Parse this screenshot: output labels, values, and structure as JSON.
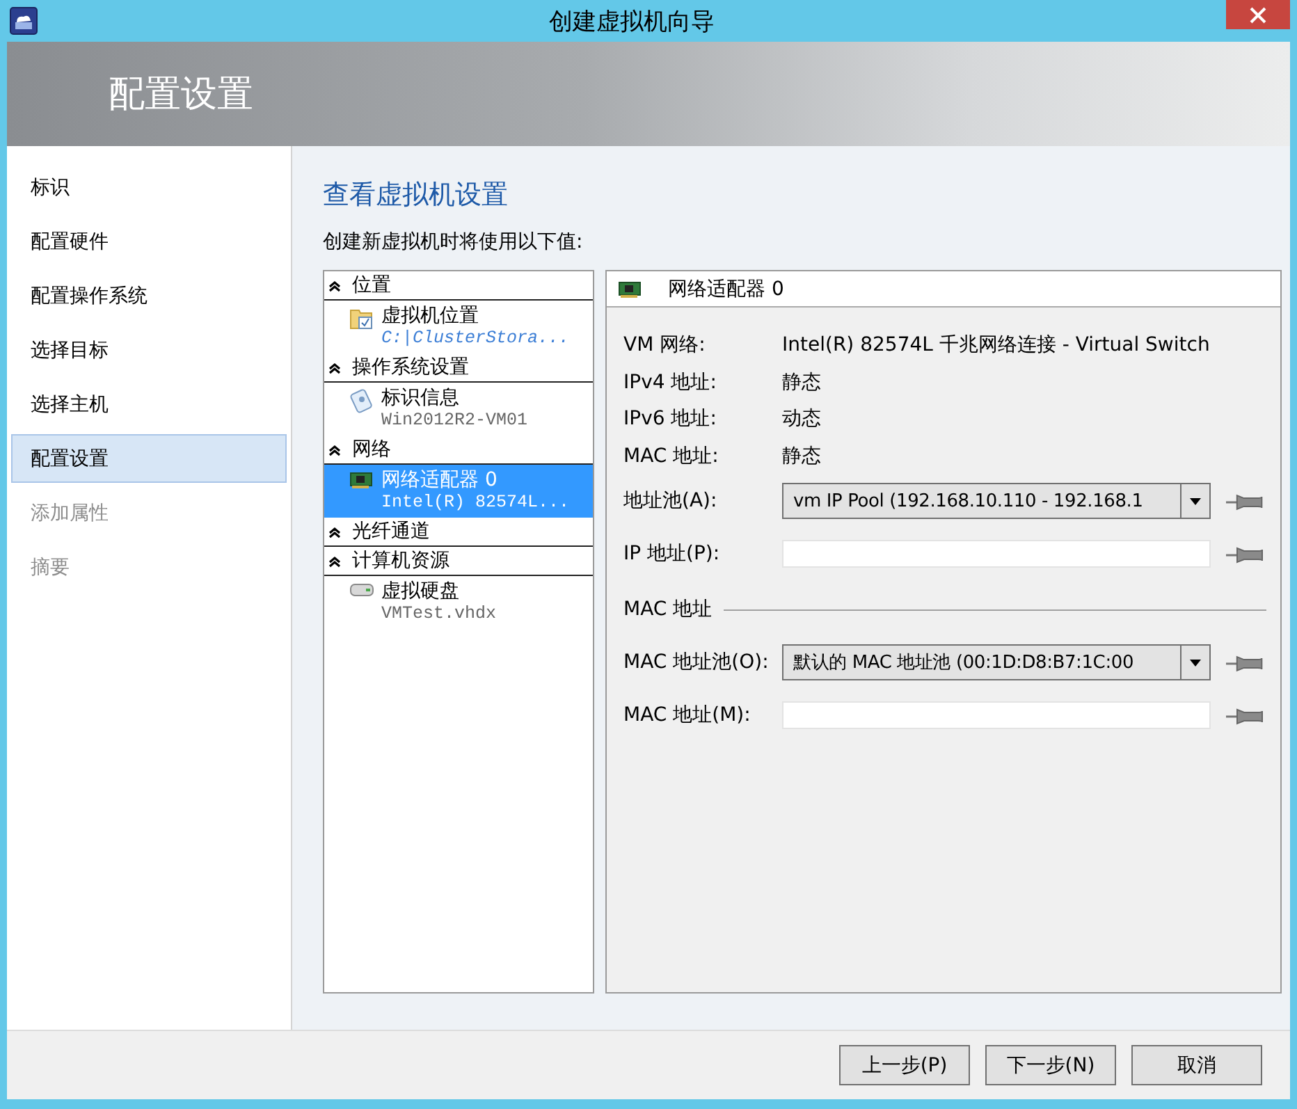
{
  "window": {
    "title": "创建虚拟机向导"
  },
  "header": {
    "title": "配置设置"
  },
  "sidebar": {
    "items": [
      {
        "label": "标识",
        "selected": false,
        "disabled": false
      },
      {
        "label": "配置硬件",
        "selected": false,
        "disabled": false
      },
      {
        "label": "配置操作系统",
        "selected": false,
        "disabled": false
      },
      {
        "label": "选择目标",
        "selected": false,
        "disabled": false
      },
      {
        "label": "选择主机",
        "selected": false,
        "disabled": false
      },
      {
        "label": "配置设置",
        "selected": true,
        "disabled": false
      },
      {
        "label": "添加属性",
        "selected": false,
        "disabled": true
      },
      {
        "label": "摘要",
        "selected": false,
        "disabled": true
      }
    ]
  },
  "page": {
    "title": "查看虚拟机设置",
    "subtitle": "创建新虚拟机时将使用以下值:"
  },
  "tree": [
    {
      "label": "位置",
      "expanded": true,
      "children": [
        {
          "kind": "folder",
          "title": "虚拟机位置",
          "subtitle": "C:|ClusterStora...",
          "selected": false
        }
      ]
    },
    {
      "label": "操作系统设置",
      "expanded": true,
      "children": [
        {
          "kind": "identity",
          "title": "标识信息",
          "subtitle": "Win2012R2-VM01",
          "selected": false
        }
      ]
    },
    {
      "label": "网络",
      "expanded": true,
      "children": [
        {
          "kind": "adapter",
          "title": "网络适配器 0",
          "subtitle": "Intel(R) 82574L...",
          "selected": true
        }
      ]
    },
    {
      "label": "光纤通道",
      "expanded": true
    },
    {
      "label": "计算机资源",
      "expanded": true,
      "children": [
        {
          "kind": "disk",
          "title": "虚拟硬盘",
          "subtitle": "VMTest.vhdx",
          "selected": false
        }
      ]
    }
  ],
  "detail": {
    "title": "网络适配器 0",
    "rows": [
      {
        "kind": "info",
        "label": "VM 网络:",
        "value": "Intel(R) 82574L 千兆网络连接 - Virtual Switch"
      },
      {
        "kind": "info",
        "label": "IPv4 地址:",
        "value": "静态"
      },
      {
        "kind": "info",
        "label": "IPv6 地址:",
        "value": "动态"
      },
      {
        "kind": "info",
        "label": "MAC 地址:",
        "value": "静态"
      },
      {
        "kind": "combo",
        "label": "地址池(A):",
        "value": "vm IP Pool (192.168.10.110 - 192.168.1"
      },
      {
        "kind": "field",
        "label": "IP 地址(P):"
      },
      {
        "kind": "section",
        "label": "MAC 地址"
      },
      {
        "kind": "combo",
        "label": "MAC 地址池(O):",
        "value": "默认的 MAC 地址池 (00:1D:D8:B7:1C:00"
      },
      {
        "kind": "field",
        "label": "MAC 地址(M):"
      }
    ]
  },
  "buttons": [
    {
      "label": "上一步(P)"
    },
    {
      "label": "下一步(N)"
    },
    {
      "label": "取消"
    }
  ]
}
